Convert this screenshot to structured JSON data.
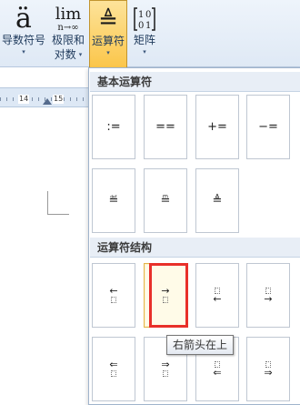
{
  "ribbon": {
    "buttons": [
      {
        "glyph": "ä",
        "label_line1": "导数符号",
        "label_line2": ""
      },
      {
        "glyph": "lim",
        "glyph_sub": "n→∞",
        "label_line1": "极限和",
        "label_line2": "对数"
      },
      {
        "glyph": "≜",
        "label_line1": "运算符",
        "label_line2": ""
      },
      {
        "glyph": "[10 01]",
        "label_line1": "矩阵",
        "label_line2": ""
      }
    ],
    "dropdown_glyph": "▾"
  },
  "ruler": {
    "mark_14": "14",
    "mark_15": "15"
  },
  "gallery": {
    "section1_title": "基本运算符",
    "basic_operators": [
      ":=",
      "==",
      "+=",
      "−=",
      "≝",
      "≞",
      "≜"
    ],
    "section2_title": "运算符结构",
    "structures": [
      {
        "arrow": "←",
        "top_placeholder": false,
        "name": "左箭头在下"
      },
      {
        "arrow": "→",
        "top_placeholder": false,
        "name": "右箭头在下"
      },
      {
        "arrow": "←",
        "top_placeholder": true,
        "name": "左箭头在上"
      },
      {
        "arrow": "→",
        "top_placeholder": true,
        "name": "右箭头在上"
      },
      {
        "arrow": "⇐",
        "top_placeholder": false,
        "name": "双左箭头在下"
      },
      {
        "arrow": "⇒",
        "top_placeholder": false,
        "name": "双右箭头在下"
      },
      {
        "arrow": "⇐",
        "top_placeholder": true,
        "name": "双左箭头在上"
      },
      {
        "arrow": "⇒",
        "top_placeholder": true,
        "name": "双右箭头在上"
      }
    ]
  },
  "tooltip": "右箭头在上",
  "colors": {
    "highlight": "#e8302a",
    "active_button": "#fbc64a"
  }
}
